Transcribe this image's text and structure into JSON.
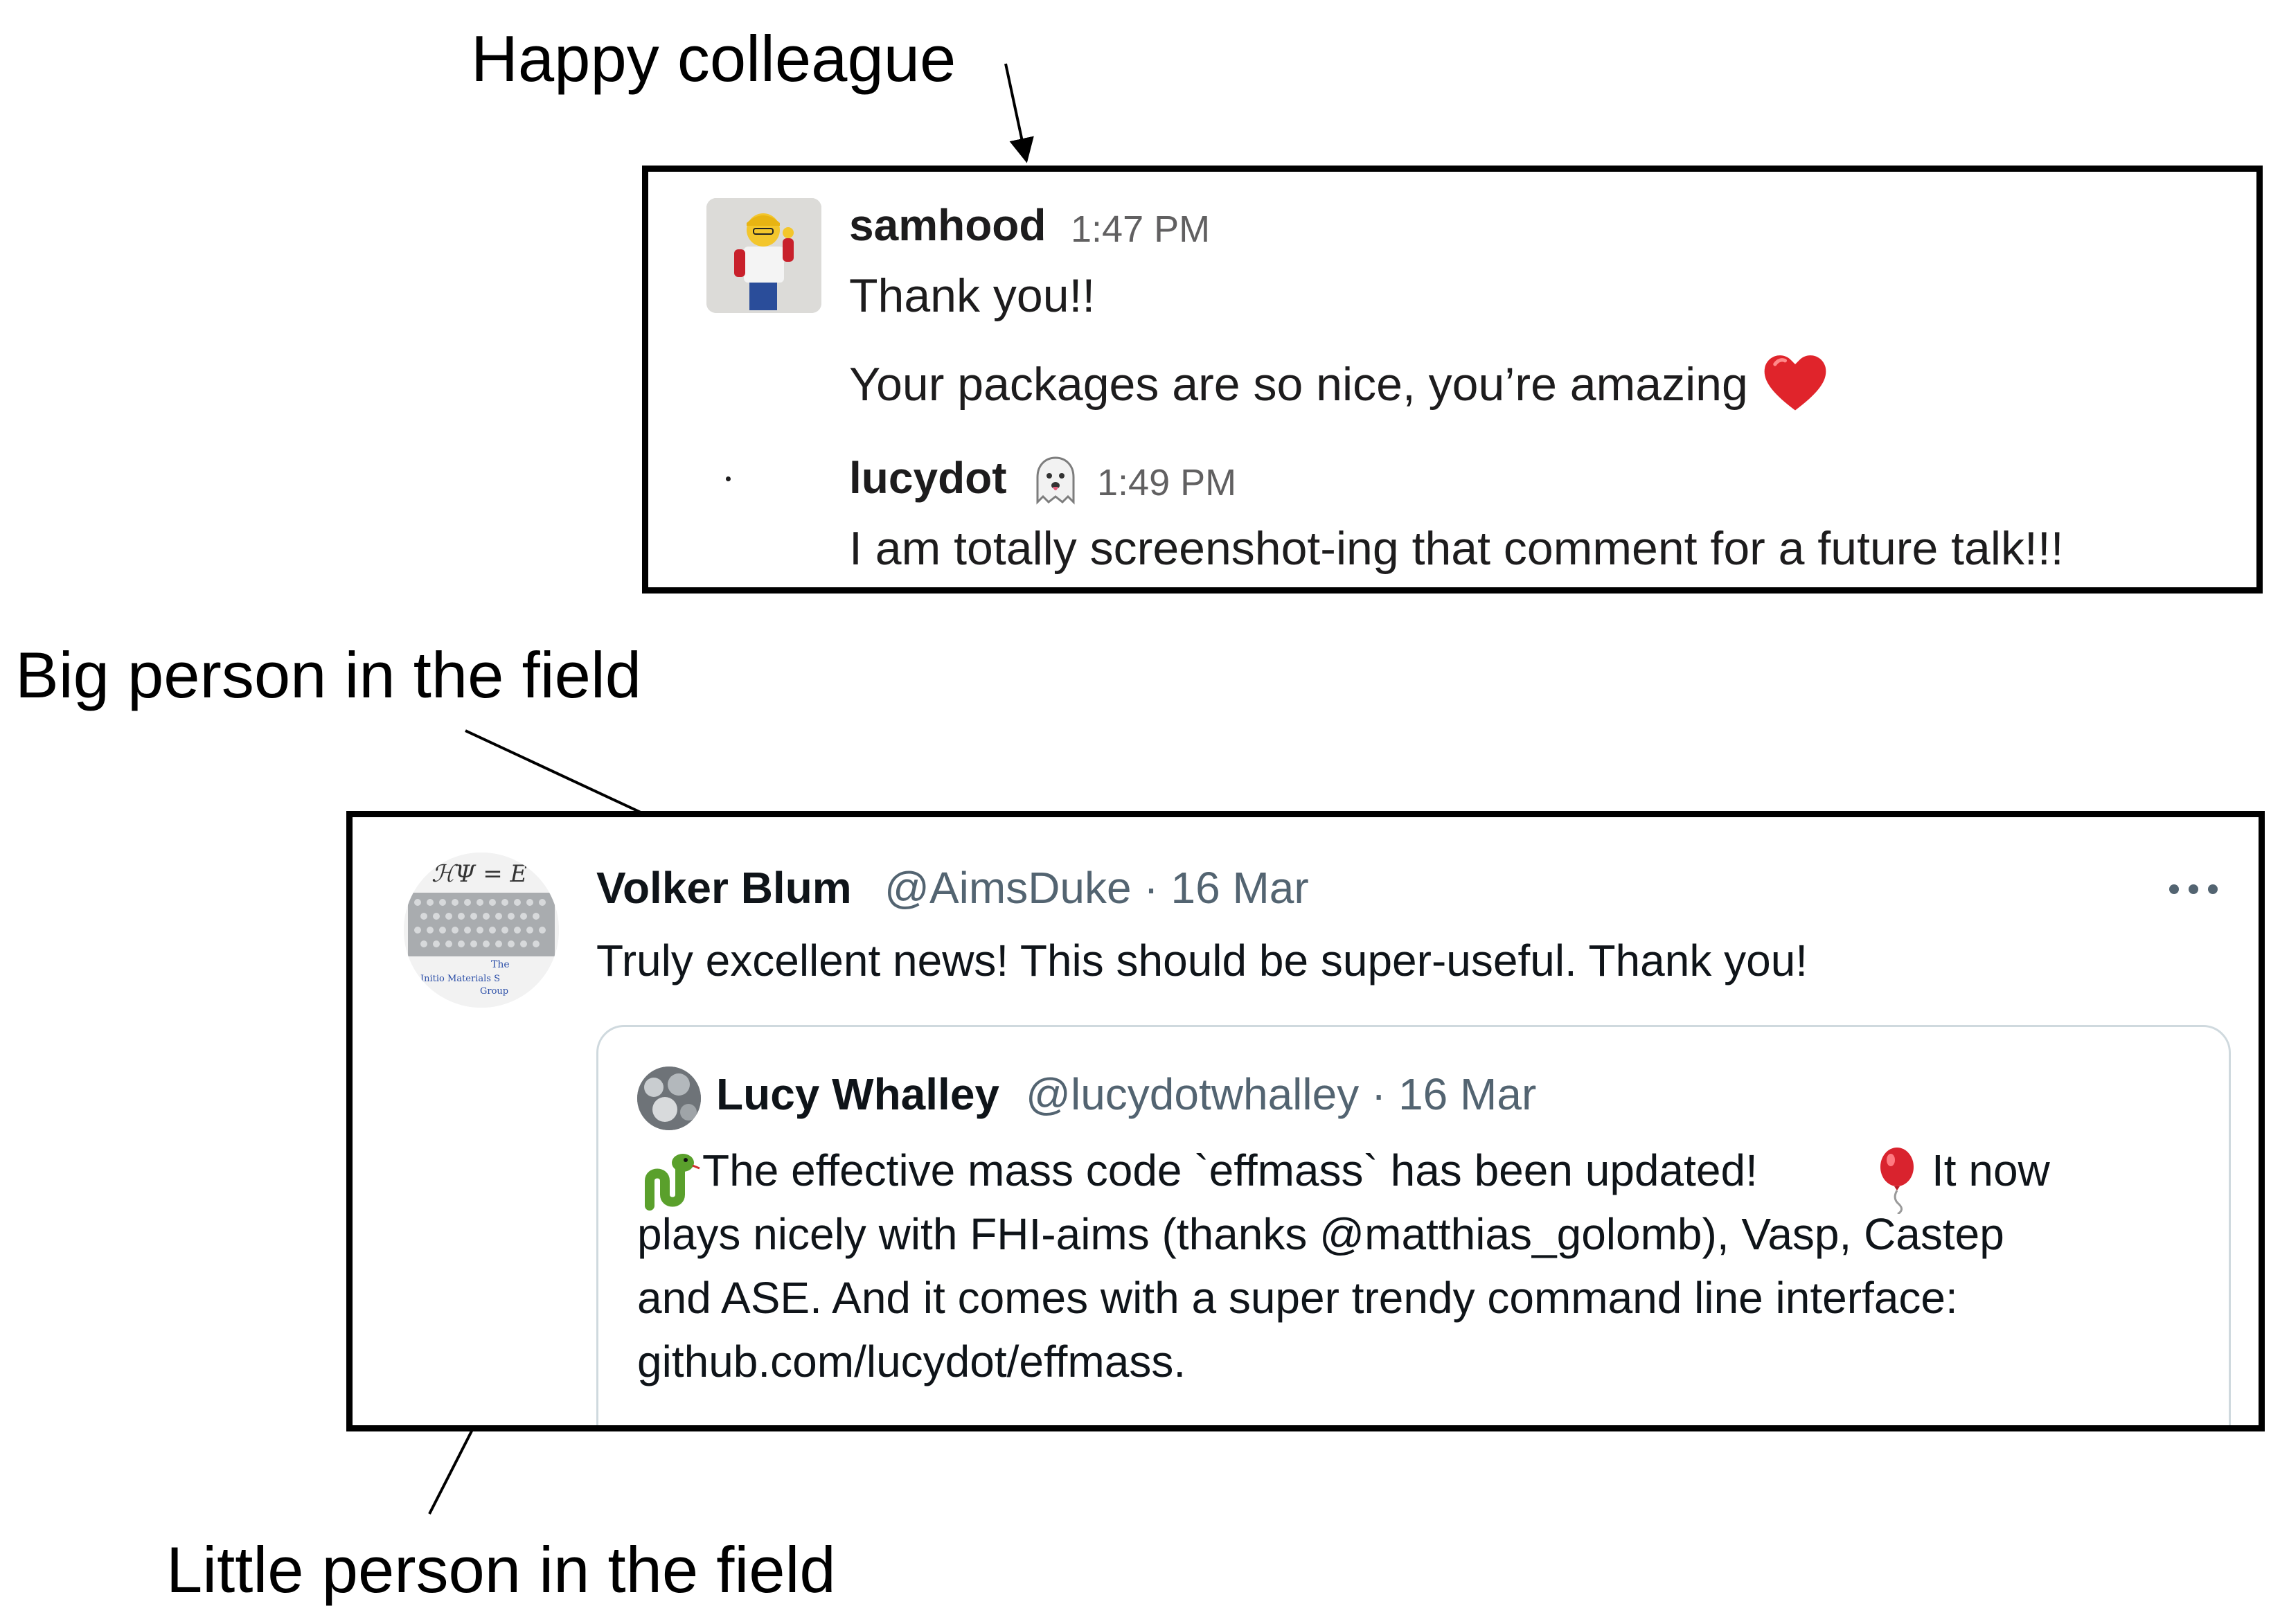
{
  "annotations": {
    "happy_colleague": "Happy colleague",
    "big_person": "Big person in the field",
    "little_person": "Little person in the field"
  },
  "slack": {
    "messages": [
      {
        "author": "samhood",
        "time": "1:47 PM",
        "lines": [
          "Thank you!!",
          "Your packages are so nice, you’re amazing"
        ],
        "emoji": "heart-icon"
      },
      {
        "author": "lucydot",
        "status_emoji": "ghost-icon",
        "time": "1:49 PM",
        "lines": [
          "I am totally screenshot-ing that comment for a future talk!!!"
        ]
      }
    ]
  },
  "tweet": {
    "author_name": "Volker Blum",
    "meta": "@AimsDuke · 16 Mar",
    "text": "Truly excellent news! This should be super-useful. Thank you!",
    "avatar_text": [
      "ℋΨ = E",
      "The",
      "Initio Materials S",
      "Group"
    ],
    "quoted": {
      "author_name": "Lucy Whalley",
      "meta": "@lucydotwhalley · 16 Mar",
      "lines": [
        "The effective mass code `effmass` has been updated! ",
        "It now",
        "plays nicely with FHI-aims (thanks @matthias_golomb), Vasp, Castep",
        "and ASE. And it comes with a super trendy command line interface:",
        "github.com/lucydot/effmass."
      ]
    }
  },
  "colors": {
    "border": "#000000",
    "slack_text": "#1d1c1d",
    "slack_muted": "#616061",
    "tweet_text": "#0f1419",
    "tweet_muted": "#536471",
    "quote_border": "#cfd9de",
    "heart": "#e0242b"
  }
}
